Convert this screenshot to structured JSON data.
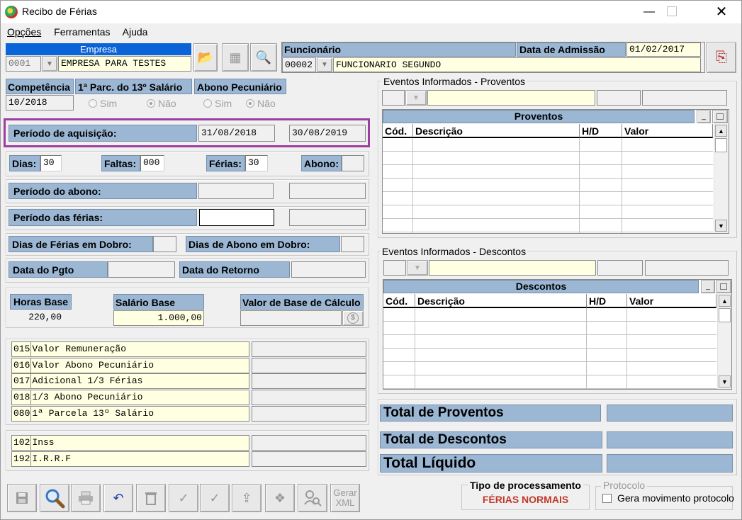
{
  "window": {
    "title": "Recibo de Férias"
  },
  "menu": {
    "items": [
      "Opções",
      "Ferramentas",
      "Ajuda"
    ]
  },
  "empresa": {
    "label": "Empresa",
    "code": "0001",
    "name": "EMPRESA PARA TESTES"
  },
  "funcionario": {
    "label": "Funcionário",
    "code": "00002",
    "name": "FUNCIONARIO SEGUNDO"
  },
  "admissao": {
    "label": "Data de Admissão",
    "value": "01/02/2017"
  },
  "competencia": {
    "label": "Competência",
    "value": "10/2018"
  },
  "parc13": {
    "label": "1ª Parc. do 13º Salário",
    "opt_sim": "Sim",
    "opt_nao": "Não",
    "selected": "Não"
  },
  "abono": {
    "label": "Abono Pecuniário",
    "opt_sim": "Sim",
    "opt_nao": "Não",
    "selected": "Não"
  },
  "aquisicao": {
    "label": "Período de aquisição:",
    "start": "31/08/2018",
    "end": "30/08/2019"
  },
  "dias": {
    "label": "Dias:",
    "value": "30"
  },
  "faltas": {
    "label": "Faltas:",
    "value": "000"
  },
  "ferias": {
    "label": "Férias:",
    "value": "30"
  },
  "abono_dias": {
    "label": "Abono:",
    "value": ""
  },
  "periodo_abono": {
    "label": "Período do abono:"
  },
  "periodo_ferias": {
    "label": "Período das férias:"
  },
  "dobro": {
    "ferias_label": "Dias de Férias em Dobro:",
    "abono_label": "Dias de Abono em Dobro:"
  },
  "datas": {
    "pgto_label": "Data do Pgto",
    "retorno_label": "Data do Retorno"
  },
  "base": {
    "horas_label": "Horas Base",
    "horas_value": "220,00",
    "salario_label": "Salário Base",
    "salario_value": "1.000,00",
    "calculo_label": "Valor de Base de Cálculo"
  },
  "proventos_rows": [
    {
      "code": "015",
      "desc": "Valor Remuneração"
    },
    {
      "code": "016",
      "desc": "Valor Abono Pecuniário"
    },
    {
      "code": "017",
      "desc": "Adicional 1/3 Férias"
    },
    {
      "code": "018",
      "desc": "1/3 Abono Pecuniário"
    },
    {
      "code": "080",
      "desc": "1ª Parcela 13º Salário"
    }
  ],
  "descontos_rows": [
    {
      "code": "102",
      "desc": "Inss"
    },
    {
      "code": "192",
      "desc": "I.R.R.F"
    }
  ],
  "eventos_proventos": {
    "group_label": "Eventos Informados - Proventos",
    "title": "Proventos",
    "columns": [
      "Cód.",
      "Descrição",
      "H/D",
      "Valor"
    ]
  },
  "eventos_descontos": {
    "group_label": "Eventos Informados - Descontos",
    "title": "Descontos",
    "columns": [
      "Cód.",
      "Descrição",
      "H/D",
      "Valor"
    ]
  },
  "totals": {
    "proventos": "Total de Proventos",
    "descontos": "Total de Descontos",
    "liquido": "Total Líquido"
  },
  "processamento": {
    "label": "Tipo de processamento",
    "value": "FÉRIAS NORMAIS"
  },
  "protocolo": {
    "group_label": "Protocolo",
    "checkbox_label": "Gera movimento protocolo"
  },
  "toolbar": {
    "gerar_xml_line1": "Gerar",
    "gerar_xml_line2": "XML"
  },
  "colors": {
    "label_blue": "#9bb7d4",
    "field_yellow": "#ffffe1",
    "highlight_purple": "#9b3fa2",
    "processamento_red": "#c0392b"
  }
}
